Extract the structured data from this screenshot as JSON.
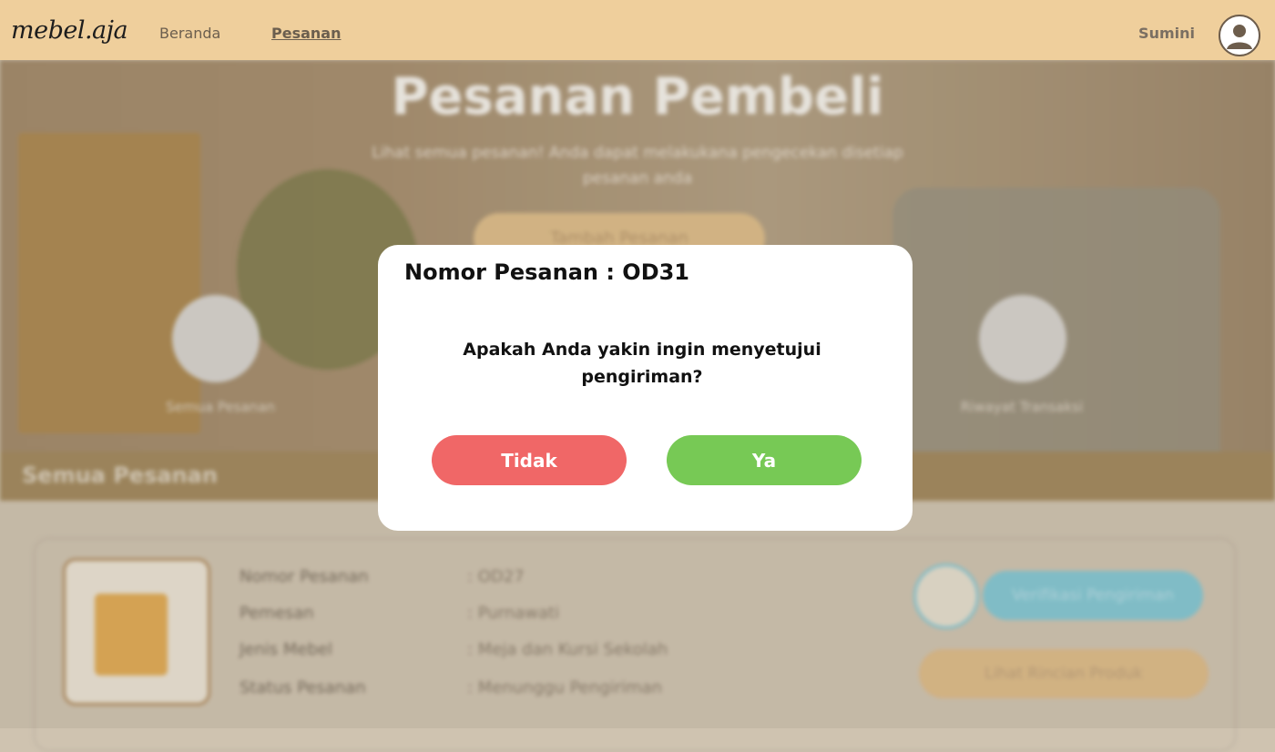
{
  "navbar": {
    "logo": "mebel.aja",
    "links": [
      {
        "label": "Beranda"
      },
      {
        "label": "Pesanan"
      }
    ],
    "user_name": "Sumini"
  },
  "hero": {
    "title": "Pesanan Pembeli",
    "subtitle": "Lihat semua pesanan! Anda dapat melakukana pengecekan disetiap pesanan anda",
    "button": "Tambah Pesanan",
    "icons": [
      {
        "label": "Semua Pesanan"
      },
      {
        "label": "Riwayat Transaksi"
      }
    ]
  },
  "section": {
    "title": "Semua Pesanan"
  },
  "order_card": {
    "rows": [
      {
        "label": "Nomor Pesanan",
        "value": ": OD27"
      },
      {
        "label": "Pemesan",
        "value": ":  Purnawati"
      },
      {
        "label": "Jenis Mebel",
        "value": ":  Meja dan Kursi Sekolah"
      },
      {
        "label": "Status Pesanan",
        "value": ":  Menunggu Pengiriman"
      }
    ],
    "verify_button": "Verifikasi Pengiriman",
    "detail_button": "Lihat Rincian Produk"
  },
  "modal": {
    "title": "Nomor Pesanan : OD31",
    "message": "Apakah Anda yakin ingin menyetujui pengiriman?",
    "no_label": "Tidak",
    "yes_label": "Ya"
  },
  "colors": {
    "navbar": "#efcf9c",
    "no_button": "#f06767",
    "yes_button": "#77c955",
    "verify_button": "#86c6d2",
    "detail_button": "#dcbb8a"
  }
}
